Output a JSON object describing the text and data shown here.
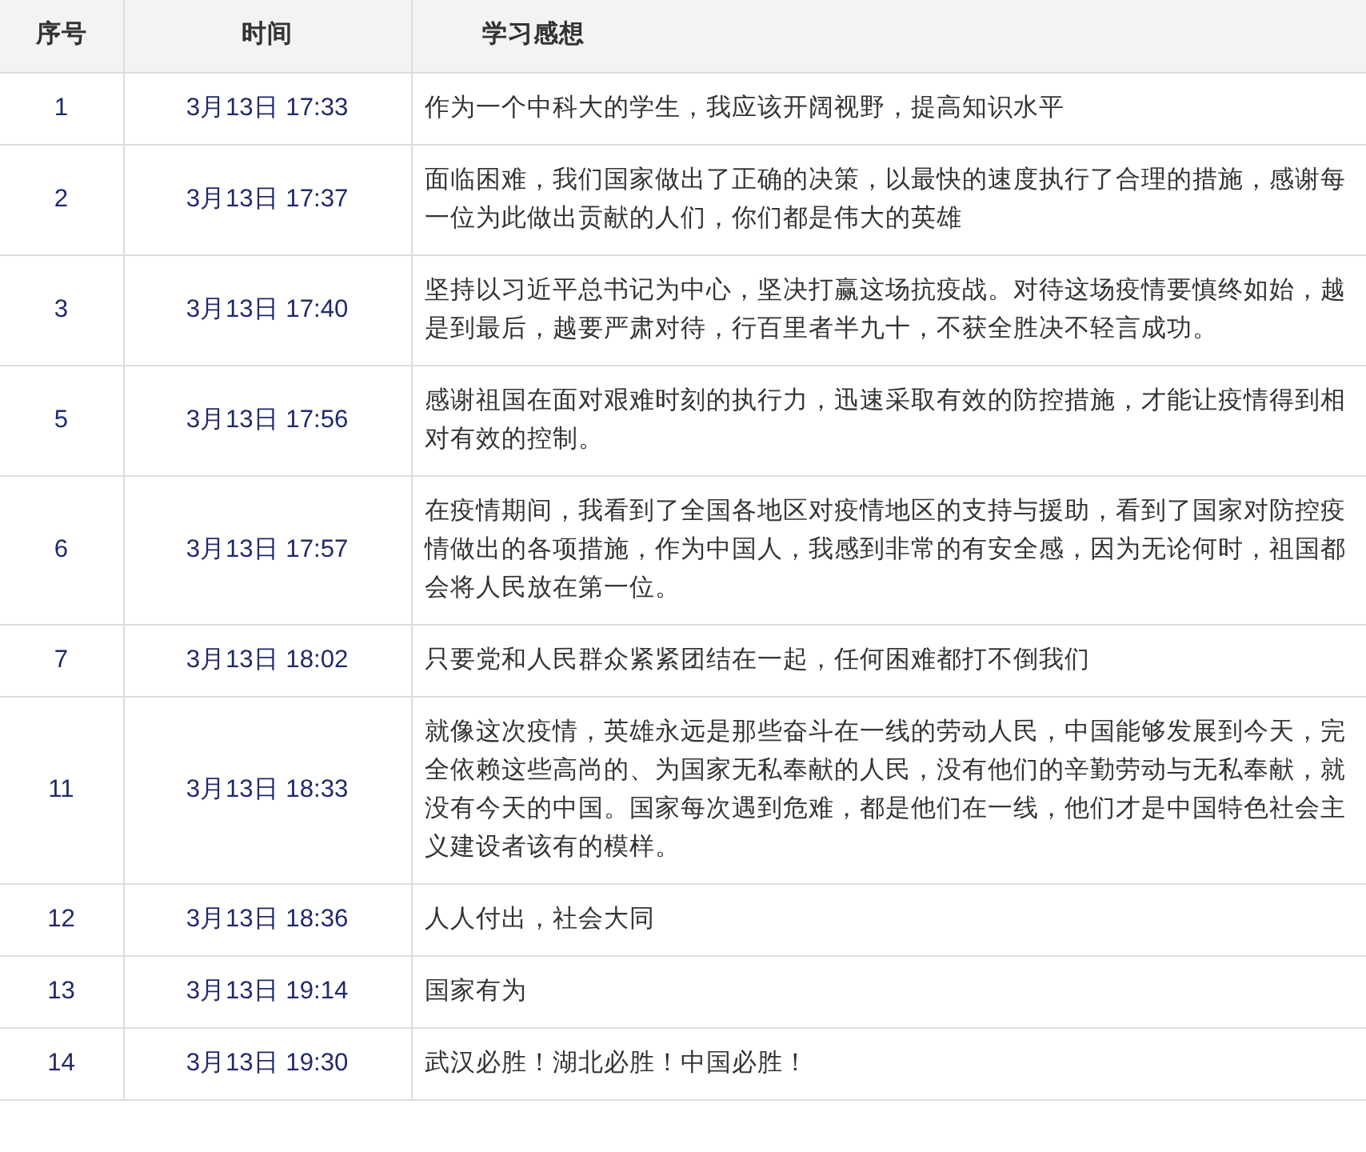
{
  "table": {
    "columns": [
      "序号",
      "时间",
      "学习感想"
    ],
    "rows": [
      {
        "number": "1",
        "time": "3月13日 17:33",
        "reflection": "作为一个中科大的学生，我应该开阔视野，提高知识水平"
      },
      {
        "number": "2",
        "time": "3月13日 17:37",
        "reflection": "面临困难，我们国家做出了正确的决策，以最快的速度执行了合理的措施，感谢每一位为此做出贡献的人们，你们都是伟大的英雄"
      },
      {
        "number": "3",
        "time": "3月13日 17:40",
        "reflection": "坚持以习近平总书记为中心，坚决打赢这场抗疫战。对待这场疫情要慎终如始，越是到最后，越要严肃对待，行百里者半九十，不获全胜决不轻言成功。"
      },
      {
        "number": "5",
        "time": "3月13日 17:56",
        "reflection": "感谢祖国在面对艰难时刻的执行力，迅速采取有效的防控措施，才能让疫情得到相对有效的控制。"
      },
      {
        "number": "6",
        "time": "3月13日 17:57",
        "reflection": "在疫情期间，我看到了全国各地区对疫情地区的支持与援助，看到了国家对防控疫情做出的各项措施，作为中国人，我感到非常的有安全感，因为无论何时，祖国都会将人民放在第一位。"
      },
      {
        "number": "7",
        "time": "3月13日 18:02",
        "reflection": "只要党和人民群众紧紧团结在一起，任何困难都打不倒我们"
      },
      {
        "number": "11",
        "time": "3月13日 18:33",
        "reflection": "就像这次疫情，英雄永远是那些奋斗在一线的劳动人民，中国能够发展到今天，完全依赖这些高尚的、为国家无私奉献的人民，没有他们的辛勤劳动与无私奉献，就没有今天的中国。国家每次遇到危难，都是他们在一线，他们才是中国特色社会主义建设者该有的模样。"
      },
      {
        "number": "12",
        "time": "3月13日 18:36",
        "reflection": "人人付出，社会大同"
      },
      {
        "number": "13",
        "time": "3月13日 19:14",
        "reflection": "国家有为"
      },
      {
        "number": "14",
        "time": "3月13日 19:30",
        "reflection": "武汉必胜！湖北必胜！中国必胜！"
      }
    ]
  }
}
